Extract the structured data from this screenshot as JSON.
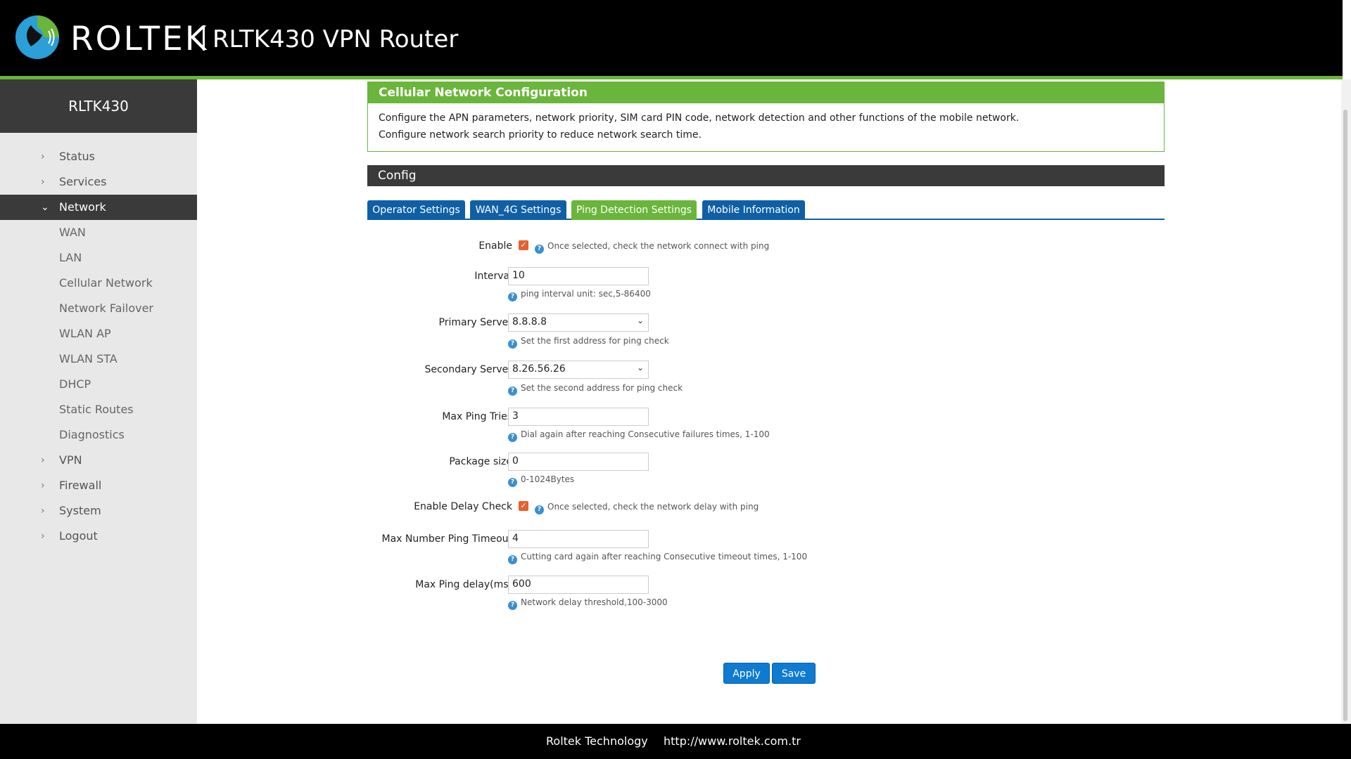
{
  "header": {
    "brand": "ROLTEK",
    "product": "RLTK430 VPN Router"
  },
  "sidebar": {
    "title": "RLTK430",
    "items": [
      {
        "label": "Status"
      },
      {
        "label": "Services"
      },
      {
        "label": "Network"
      },
      {
        "label": "VPN"
      },
      {
        "label": "Firewall"
      },
      {
        "label": "System"
      },
      {
        "label": "Logout"
      }
    ],
    "network_sub": [
      "WAN",
      "LAN",
      "Cellular Network",
      "Network Failover",
      "WLAN AP",
      "WLAN STA",
      "DHCP",
      "Static Routes",
      "Diagnostics"
    ]
  },
  "info": {
    "title": "Cellular Network Configuration",
    "line1": "Configure the APN parameters, network priority, SIM card PIN code, network detection and other functions of the mobile network.",
    "line2": "Configure network search priority to reduce network search time."
  },
  "config_title": "Config",
  "tabs": [
    {
      "label": "Operator Settings"
    },
    {
      "label": "WAN_4G Settings"
    },
    {
      "label": "Ping Detection Settings"
    },
    {
      "label": "Mobile Information"
    }
  ],
  "form": {
    "enable": {
      "label": "Enable",
      "checked": true,
      "hint": "Once selected, check the network connect with ping"
    },
    "interval": {
      "label": "Interval",
      "value": "10",
      "hint": "ping interval unit: sec,5-86400"
    },
    "primary": {
      "label": "Primary Server",
      "value": "8.8.8.8",
      "hint": "Set the first address for ping check"
    },
    "secondary": {
      "label": "Secondary Server",
      "value": "8.26.56.26",
      "hint": "Set the second address for ping check"
    },
    "max_tries": {
      "label": "Max Ping Tries",
      "value": "3",
      "hint": "Dial again after reaching Consecutive failures times, 1-100"
    },
    "package": {
      "label": "Package size",
      "value": "0",
      "hint": "0-1024Bytes"
    },
    "delay_check": {
      "label": "Enable Delay Check",
      "checked": true,
      "hint": "Once selected, check the network delay with ping"
    },
    "max_timeout": {
      "label": "Max Number Ping Timeout",
      "value": "4",
      "hint": "Cutting card again after reaching Consecutive timeout times, 1-100"
    },
    "max_delay": {
      "label": "Max Ping delay(ms)",
      "value": "600",
      "hint": "Network delay threshold,100-3000"
    }
  },
  "buttons": {
    "apply": "Apply",
    "save": "Save"
  },
  "footer": {
    "company": "Roltek Technology",
    "url": "http://www.roltek.com.tr"
  },
  "icons": {
    "help": "?",
    "check": "✓",
    "chevron_right": "›",
    "chevron_down": "⌄"
  },
  "colors": {
    "accent_green": "#6ab53b",
    "tab_blue": "#0f5fa6",
    "button_blue": "#0f7ad1",
    "checkbox_orange": "#e8602c"
  }
}
